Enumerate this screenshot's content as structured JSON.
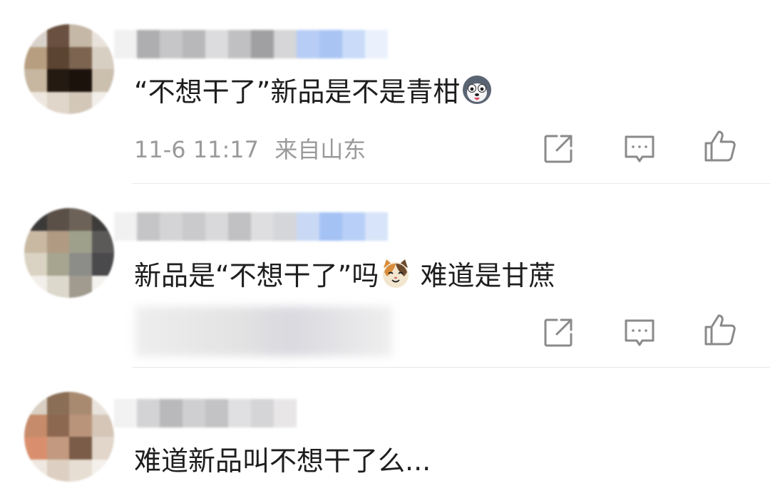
{
  "comments": [
    {
      "text": "“不想干了”新品是不是青柑",
      "emoji": "husky-emoji",
      "time": "11-6 11:17",
      "location": "来自山东"
    },
    {
      "text_before": "新品是“不想干了”吗",
      "emoji": "cat-emoji",
      "text_after": " 难道是甘蔗"
    },
    {
      "text": "难道新品叫不想干了么..."
    }
  ],
  "icons": {
    "share": "share-icon",
    "comment": "comment-icon",
    "like": "thumbs-up-icon"
  },
  "colors": {
    "text": "#1e1e1e",
    "meta": "#9a9a9a",
    "icon": "#8a8a8a",
    "divider": "#e8e8e8"
  }
}
